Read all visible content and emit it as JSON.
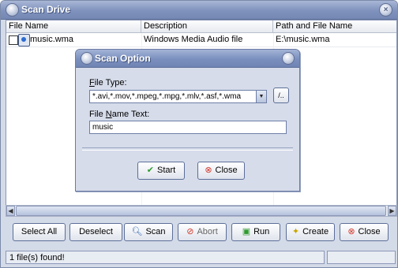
{
  "window": {
    "title": "Scan Drive"
  },
  "list": {
    "columns": [
      "File Name",
      "Description",
      "Path and File Name"
    ],
    "rows": [
      {
        "name": "music.wma",
        "description": "Windows Media Audio file",
        "path": "E:\\music.wma"
      }
    ]
  },
  "buttons": {
    "select_all": "Select All",
    "deselect": "Deselect",
    "scan": "Scan",
    "abort": "Abort",
    "run": "Run",
    "create": "Create",
    "close": "Close"
  },
  "icons": {
    "scan": "magnifier-icon",
    "abort": "stop-icon",
    "run": "run-icon",
    "create": "create-icon",
    "close": "close-icon"
  },
  "status": {
    "message": "1 file(s) found!"
  },
  "dialog": {
    "title": "Scan Option",
    "file_type_label_accel": "F",
    "file_type_label_rest": "ile Type:",
    "file_type_value": "*.avi,*.mov,*.mpeg,*.mpg,*.mlv,*.asf,*.wma",
    "browse_label": "/..",
    "name_label_pre": "File ",
    "name_label_accel": "N",
    "name_label_rest": "ame Text:",
    "name_value": "music",
    "start_label": "Start",
    "close_label": "Close"
  },
  "colors": {
    "titlebar": "#7f92bd",
    "window_bg": "#d4dbe8",
    "accent_green": "#2f9a2f",
    "accent_red": "#d23a2f"
  }
}
